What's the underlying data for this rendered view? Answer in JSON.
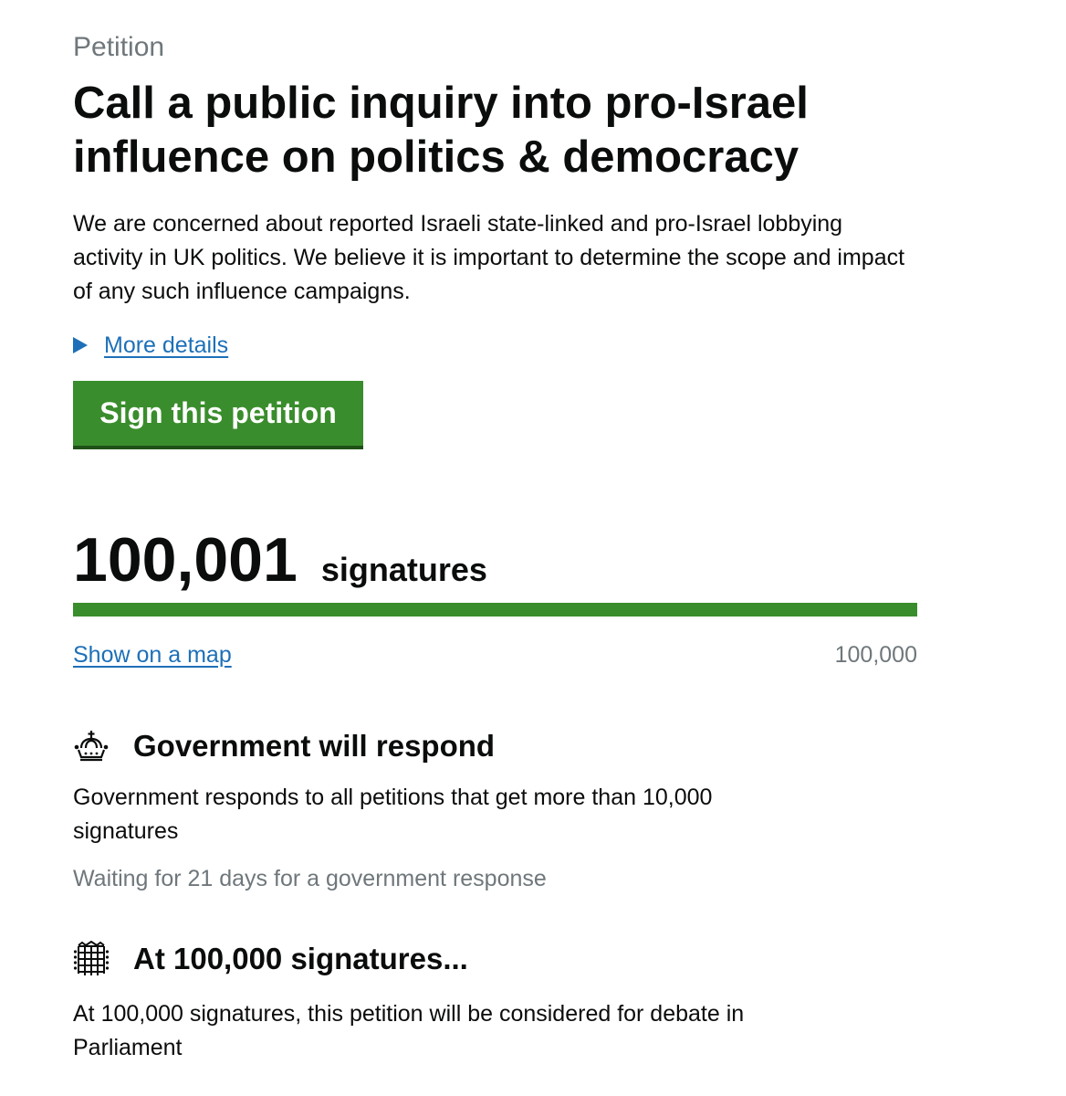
{
  "petition": {
    "caption": "Petition",
    "title": "Call a public inquiry into pro-Israel influence on politics & democracy",
    "summary": "We are concerned about reported Israeli state-linked and pro-Israel lobbying activity in UK politics. We believe it is important to determine the scope and impact of any such influence campaigns.",
    "more_details_label": "More details",
    "sign_button_label": "Sign this petition"
  },
  "signatures": {
    "count": "100,001",
    "label": "signatures",
    "progress_fraction": 1.0,
    "show_on_map_label": "Show on a map",
    "target_label": "100,000"
  },
  "government_response": {
    "icon": "crown-icon",
    "title": "Government will respond",
    "text": "Government responds to all petitions that get more than 10,000 signatures",
    "status": "Waiting for 21 days for a government response"
  },
  "debate": {
    "icon": "portcullis-icon",
    "title": "At 100,000 signatures...",
    "text": "At 100,000 signatures, this petition will be considered for debate in Parliament"
  },
  "colors": {
    "link": "#1d70b8",
    "button_green": "#3a8d2c",
    "secondary_text": "#6f777b",
    "text": "#0b0c0c"
  }
}
